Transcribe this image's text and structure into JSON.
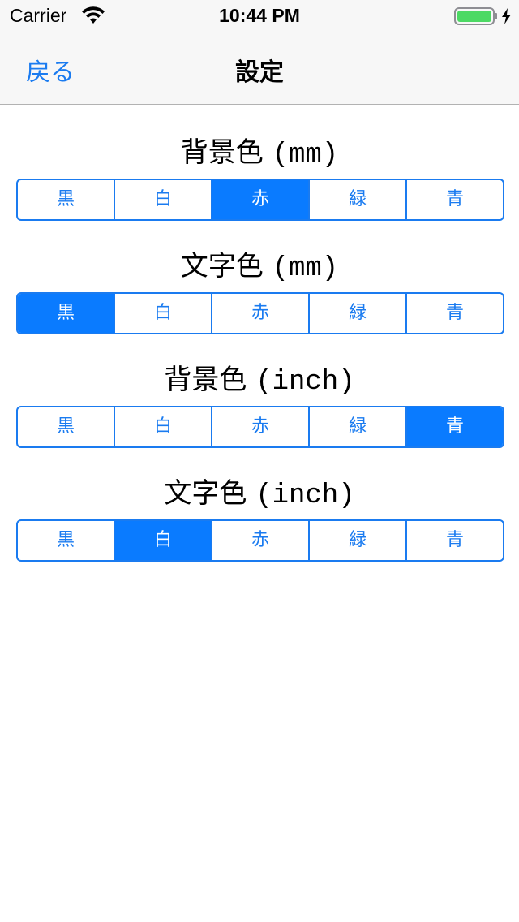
{
  "status": {
    "carrier": "Carrier",
    "time": "10:44 PM"
  },
  "nav": {
    "back_label": "戻る",
    "title": "設定"
  },
  "sections": [
    {
      "title": "背景色",
      "unit": "(mm)",
      "selected": 2
    },
    {
      "title": "文字色",
      "unit": "(mm)",
      "selected": 0
    },
    {
      "title": "背景色",
      "unit": "(inch)",
      "selected": 4
    },
    {
      "title": "文字色",
      "unit": "(inch)",
      "selected": 1
    }
  ],
  "options": [
    "黒",
    "白",
    "赤",
    "緑",
    "青"
  ],
  "colors": {
    "accent": "#0a7bff",
    "battery": "#4cd964"
  }
}
